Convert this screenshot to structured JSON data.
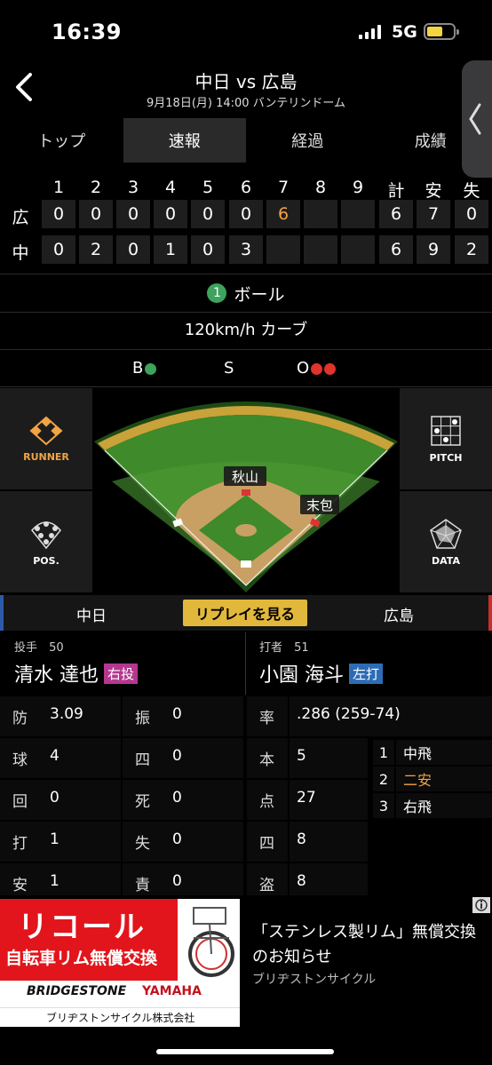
{
  "status": {
    "time": "16:39",
    "network": "5G"
  },
  "header": {
    "title": "中日 vs 広島",
    "subtitle": "9月18日(月) 14:00 バンテリンドーム"
  },
  "tabs": [
    {
      "label": "トップ"
    },
    {
      "label": "速報"
    },
    {
      "label": "経過"
    },
    {
      "label": "成績"
    }
  ],
  "scoreboard": {
    "headers": [
      "1",
      "2",
      "3",
      "4",
      "5",
      "6",
      "7",
      "8",
      "9",
      "計",
      "安",
      "失"
    ],
    "rows": [
      {
        "team": "広",
        "cells": [
          "0",
          "0",
          "0",
          "0",
          "0",
          "0",
          "6",
          "",
          "",
          "6",
          "7",
          "0"
        ]
      },
      {
        "team": "中",
        "cells": [
          "0",
          "2",
          "0",
          "1",
          "0",
          "3",
          "",
          "",
          "",
          "6",
          "9",
          "2"
        ]
      }
    ]
  },
  "pitch": {
    "count": "1",
    "result": "ボール",
    "detail": "120km/h カーブ"
  },
  "bso": {
    "b": "B",
    "s": "S",
    "o": "O"
  },
  "field": {
    "runner_label": "RUNNER",
    "pitch_label": "PITCH",
    "pos_label": "POS.",
    "data_label": "DATA",
    "fielder1": "秋山",
    "fielder2": "末包"
  },
  "teambar": {
    "home": "中日",
    "replay": "リプレイを見る",
    "away": "広島"
  },
  "pitcher": {
    "label": "投手",
    "number": "50",
    "name": "清水 達也",
    "hand": "右投"
  },
  "batter": {
    "label": "打者",
    "number": "51",
    "name": "小園 海斗",
    "hand": "左打"
  },
  "pitcher_stats": [
    {
      "k1": "防",
      "v1": "3.09",
      "k2": "振",
      "v2": "0"
    },
    {
      "k1": "球",
      "v1": "4",
      "k2": "四",
      "v2": "0"
    },
    {
      "k1": "回",
      "v1": "0",
      "k2": "死",
      "v2": "0"
    },
    {
      "k1": "打",
      "v1": "1",
      "k2": "失",
      "v2": "0"
    },
    {
      "k1": "安",
      "v1": "1",
      "k2": "責",
      "v2": "0"
    }
  ],
  "batter_stats": [
    {
      "k": "率",
      "v": ".286 (259-74)"
    },
    {
      "k": "本",
      "v": "5"
    },
    {
      "k": "点",
      "v": "27"
    },
    {
      "k": "四",
      "v": "8"
    },
    {
      "k": "盗",
      "v": "8"
    }
  ],
  "at_bats": [
    {
      "n": "1",
      "r": "中飛"
    },
    {
      "n": "2",
      "r": "二安"
    },
    {
      "n": "3",
      "r": "右飛"
    }
  ],
  "ad": {
    "banner_title": "リコール",
    "banner_sub": "自転車リム無償交換",
    "brand1": "BRIDGESTONE",
    "brand2": "YAMAHA",
    "maker": "ブリヂストンサイクル株式会社",
    "headline": "「ステンレス製リム」無償交換のお知らせ",
    "advertiser": "ブリヂストンサイクル"
  },
  "colors": {
    "accent": "#e1b83b",
    "green": "#3da35d",
    "red": "#e0332c",
    "orange": "#f2a444",
    "pitcher_badge": "#b5378f",
    "batter_badge": "#2d6cb5"
  }
}
